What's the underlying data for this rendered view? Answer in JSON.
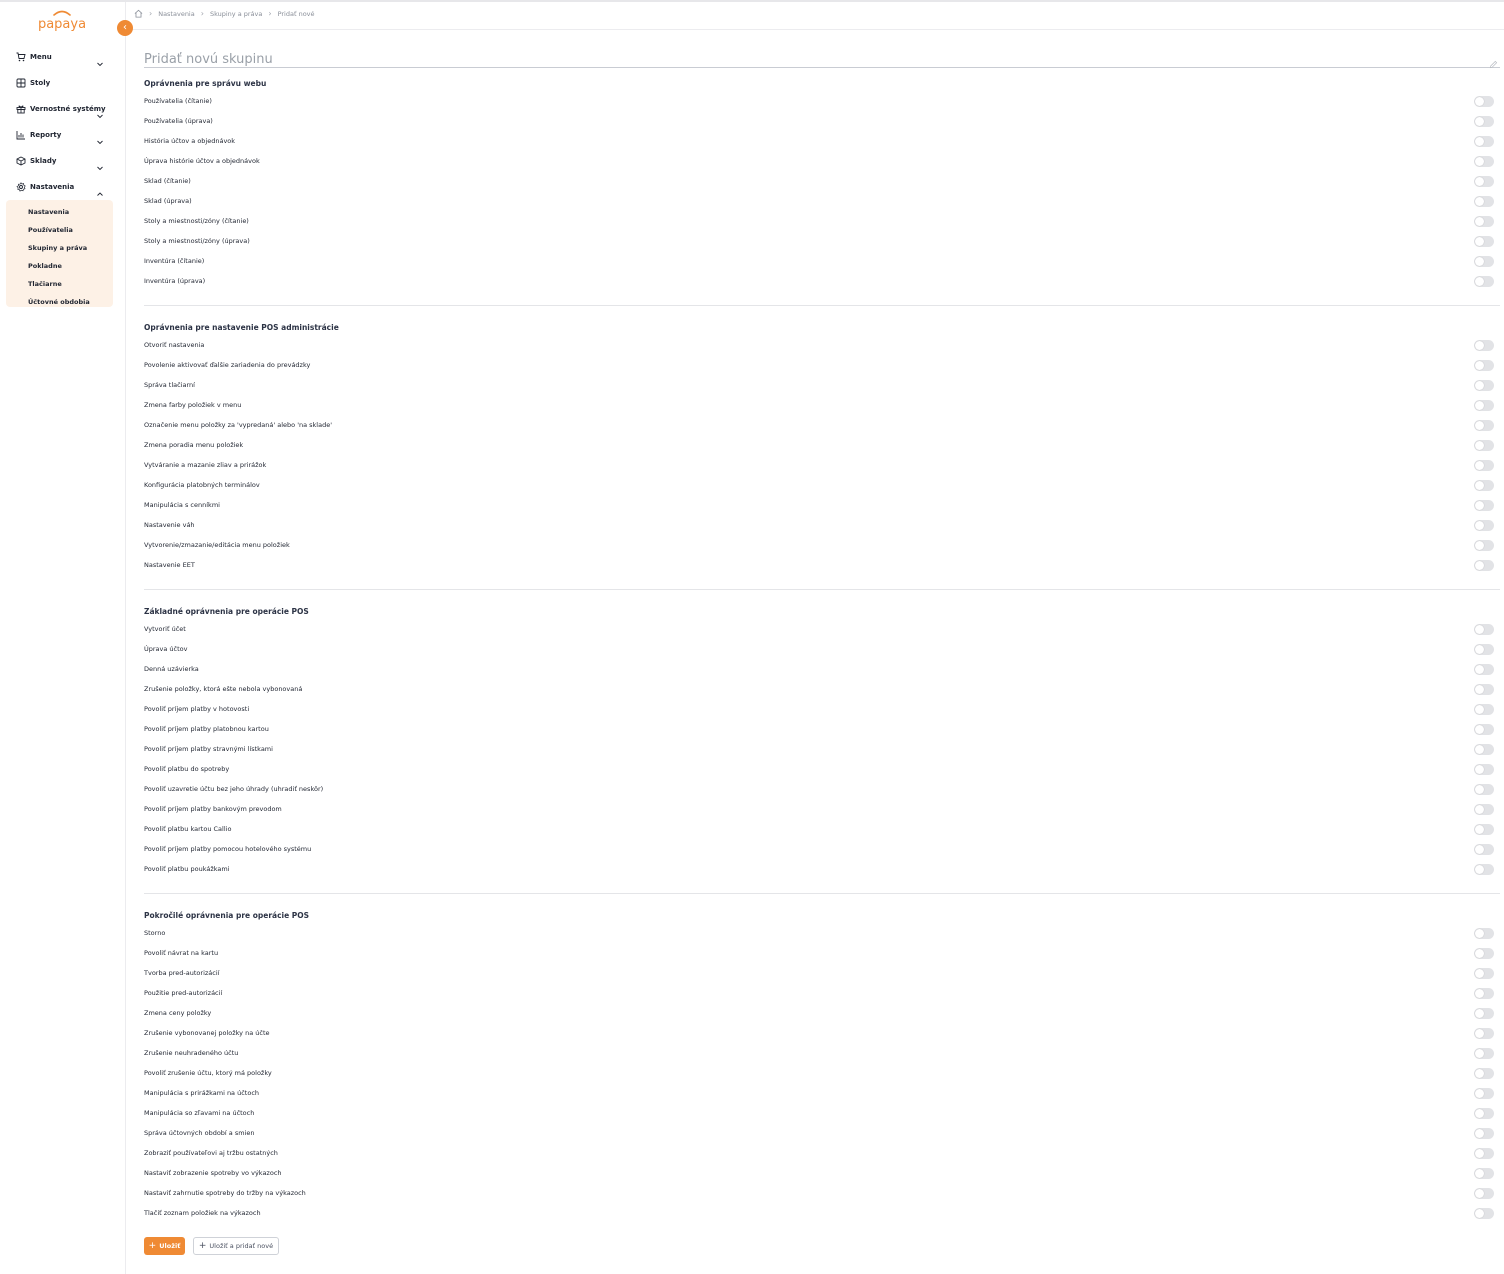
{
  "app": {
    "logo_text": "papaya",
    "brand_color": "#ef8a34"
  },
  "sidebar": {
    "items": [
      {
        "label": "Menu",
        "icon": "cart-icon",
        "expandable": true
      },
      {
        "label": "Stoly",
        "icon": "grid-icon",
        "expandable": false
      },
      {
        "label": "Vernostné systémy",
        "icon": "gift-icon",
        "expandable": true
      },
      {
        "label": "Reporty",
        "icon": "chart-icon",
        "expandable": true
      },
      {
        "label": "Sklady",
        "icon": "box-icon",
        "expandable": true
      },
      {
        "label": "Nastavenia",
        "icon": "gear-icon",
        "expandable": true,
        "expanded": true
      }
    ],
    "submenu": [
      "Nastavenia",
      "Používatelia",
      "Skupiny a práva",
      "Pokladne",
      "Tlačiarne",
      "Účtovné obdobia"
    ]
  },
  "breadcrumb": [
    "Nastavenia",
    "Skupiny a práva",
    "Pridať nové"
  ],
  "form": {
    "title_placeholder": "Pridať novú skupinu"
  },
  "sections": [
    {
      "title": "Oprávnenia pre správu webu",
      "permissions": [
        "Používatelia (čítanie)",
        "Používatelia (úprava)",
        "História účtov a objednávok",
        "Úprava histórie účtov a objednávok",
        "Sklad (čítanie)",
        "Sklad (úprava)",
        "Stoly a miestnosti/zóny (čítanie)",
        "Stoly a miestnosti/zóny (úprava)",
        "Inventúra (čítanie)",
        "Inventúra (úprava)"
      ]
    },
    {
      "title": "Oprávnenia pre nastavenie POS administrácie",
      "permissions": [
        "Otvoriť nastavenia",
        "Povolenie aktivovať ďalšie zariadenia do prevádzky",
        "Správa tlačiarní",
        "Zmena farby položiek v menu",
        "Označenie menu položky za 'vypredaná' alebo 'na sklade'",
        "Zmena poradia menu položiek",
        "Vytváranie a mazanie zliav a prirážok",
        "Konfigurácia platobných terminálov",
        "Manipulácia s cenníkmi",
        "Nastavenie váh",
        "Vytvorenie/zmazanie/editácia menu položiek",
        "Nastavenie EET"
      ]
    },
    {
      "title": "Základné oprávnenia pre operácie POS",
      "permissions": [
        "Vytvoriť účet",
        "Úprava účtov",
        "Denná uzávierka",
        "Zrušenie položky, ktorá ešte nebola vybonovaná",
        "Povoliť príjem platby v hotovosti",
        "Povoliť príjem platby platobnou kartou",
        "Povoliť príjem platby stravnými lístkami",
        "Povoliť platbu do spotreby",
        "Povoliť uzavretie účtu bez jeho úhrady (uhradiť neskôr)",
        "Povoliť príjem platby bankovým prevodom",
        "Povoliť platbu kartou Callio",
        "Povoliť príjem platby pomocou hotelového systému",
        "Povoliť platbu poukážkami"
      ]
    },
    {
      "title": "Pokročilé oprávnenia pre operácie POS",
      "permissions": [
        "Storno",
        "Povoliť návrat na kartu",
        "Tvorba pred-autorizácií",
        "Použitie pred-autorizácií",
        "Zmena ceny položky",
        "Zrušenie vybonovanej položky na účte",
        "Zrušenie neuhradeného účtu",
        "Povoliť zrušenie účtu, ktorý má položky",
        "Manipulácia s prirážkami na účtoch",
        "Manipulácia so zľavami na účtoch",
        "Správa účtovných období a smien",
        "Zobraziť používateľovi aj tržbu ostatných",
        "Nastaviť zobrazenie spotreby vo výkazoch",
        "Nastaviť zahrnutie spotreby do tržby na výkazoch",
        "Tlačiť zoznam položiek na výkazoch"
      ]
    }
  ],
  "actions": {
    "save_label": "Uložiť",
    "save_add_label": "Uložiť a pridať nové"
  }
}
